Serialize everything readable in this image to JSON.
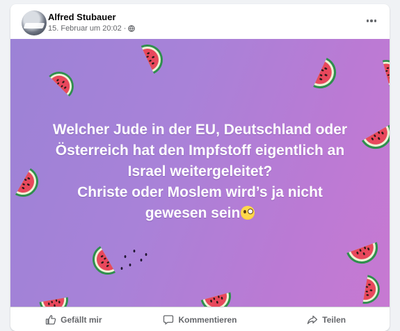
{
  "post": {
    "author": "Alfred Stubauer",
    "date": "15. Februar um 20:02",
    "separator": "·",
    "privacy_icon": "globe-icon",
    "more_icon": "more-options-icon",
    "text_lines": [
      "Welcher Jude in der EU, Deutschland oder",
      "Österreich hat den Impfstoff eigentlich an",
      "Israel weitergeleitet?",
      "Christe oder Moslem wird’s ja nicht",
      "gewesen sein"
    ],
    "emoji": "face-with-monocle-emoji",
    "background": {
      "pattern": "watermelon-slices",
      "gradient_start": "#9c82d6",
      "gradient_end": "#c779d2"
    }
  },
  "actions": {
    "like_label": "Gefällt mir",
    "comment_label": "Kommentieren",
    "share_label": "Teilen",
    "like_icon": "thumbs-up-icon",
    "comment_icon": "comment-icon",
    "share_icon": "share-icon"
  },
  "colors": {
    "text_primary": "#050505",
    "text_secondary": "#65676b",
    "watermelon_flesh": "#e8485c",
    "watermelon_rind": "#3aa35c"
  }
}
